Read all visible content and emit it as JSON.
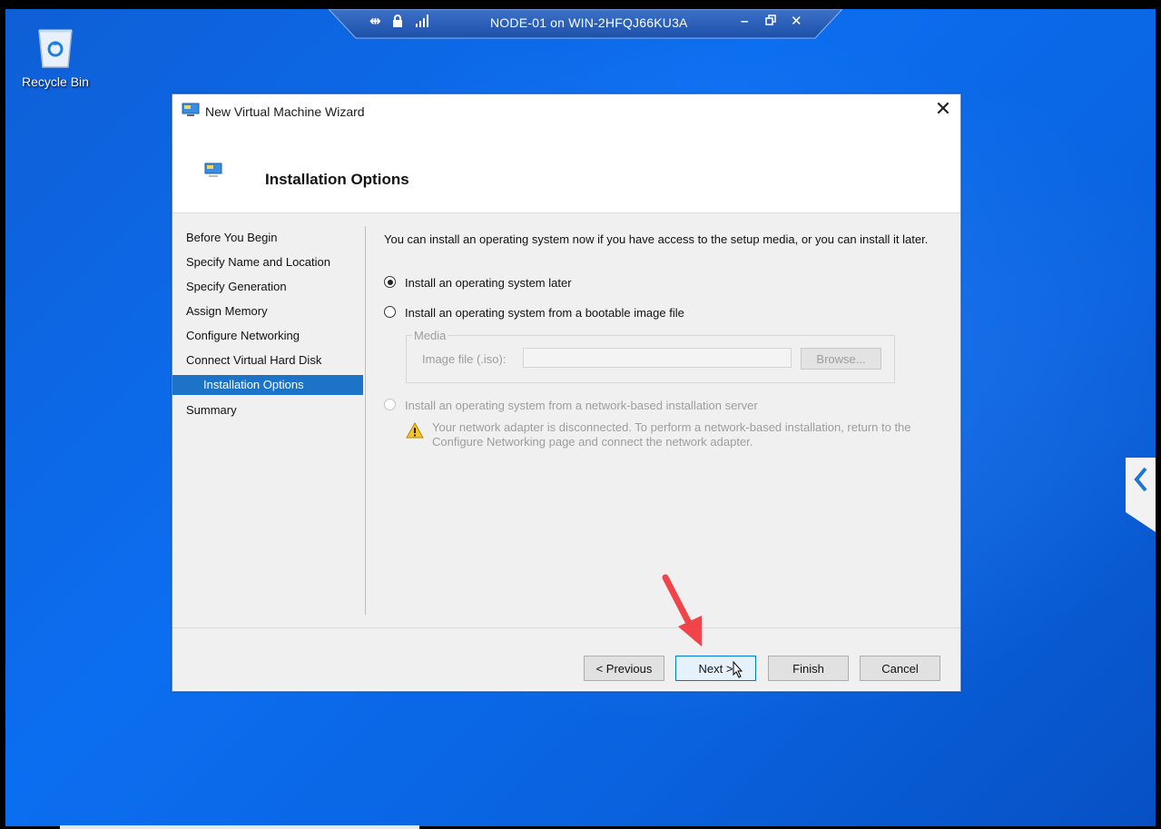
{
  "connection_bar": {
    "title": "NODE-01 on WIN-2HFQJ66KU3A",
    "icons": [
      "pin-icon",
      "lock-icon",
      "signal-icon",
      "minimize-icon",
      "restore-icon",
      "close-icon"
    ]
  },
  "desktop": {
    "recycle_bin_label": "Recycle Bin"
  },
  "wizard": {
    "title": "New Virtual Machine Wizard",
    "page_title": "Installation Options",
    "close_glyph": "✕",
    "nav_items": [
      {
        "label": "Before You Begin",
        "active": false
      },
      {
        "label": "Specify Name and Location",
        "active": false
      },
      {
        "label": "Specify Generation",
        "active": false
      },
      {
        "label": "Assign Memory",
        "active": false
      },
      {
        "label": "Configure Networking",
        "active": false
      },
      {
        "label": "Connect Virtual Hard Disk",
        "active": false
      },
      {
        "label": "Installation Options",
        "active": true
      },
      {
        "label": "Summary",
        "active": false
      }
    ],
    "intro_text": "You can install an operating system now if you have access to the setup media, or you can install it later.",
    "options": [
      {
        "label": "Install an operating system later",
        "selected": true,
        "enabled": true
      },
      {
        "label": "Install an operating system from a bootable image file",
        "selected": false,
        "enabled": true
      },
      {
        "label": "Install an operating system from a network-based installation server",
        "selected": false,
        "enabled": false
      }
    ],
    "media": {
      "legend": "Media",
      "image_file_label": "Image file (.iso):",
      "image_file_value": "",
      "browse_label": "Browse..."
    },
    "warning_text": "Your network adapter is disconnected. To perform a network-based installation, return to the Configure Networking page and connect the network adapter.",
    "buttons": {
      "previous": "< Previous",
      "next": "Next >",
      "finish": "Finish",
      "cancel": "Cancel"
    }
  },
  "colors": {
    "desktop_blue": "#0b6ef0",
    "nav_active": "#1d73c7",
    "annotation_arrow": "#f0444a"
  }
}
